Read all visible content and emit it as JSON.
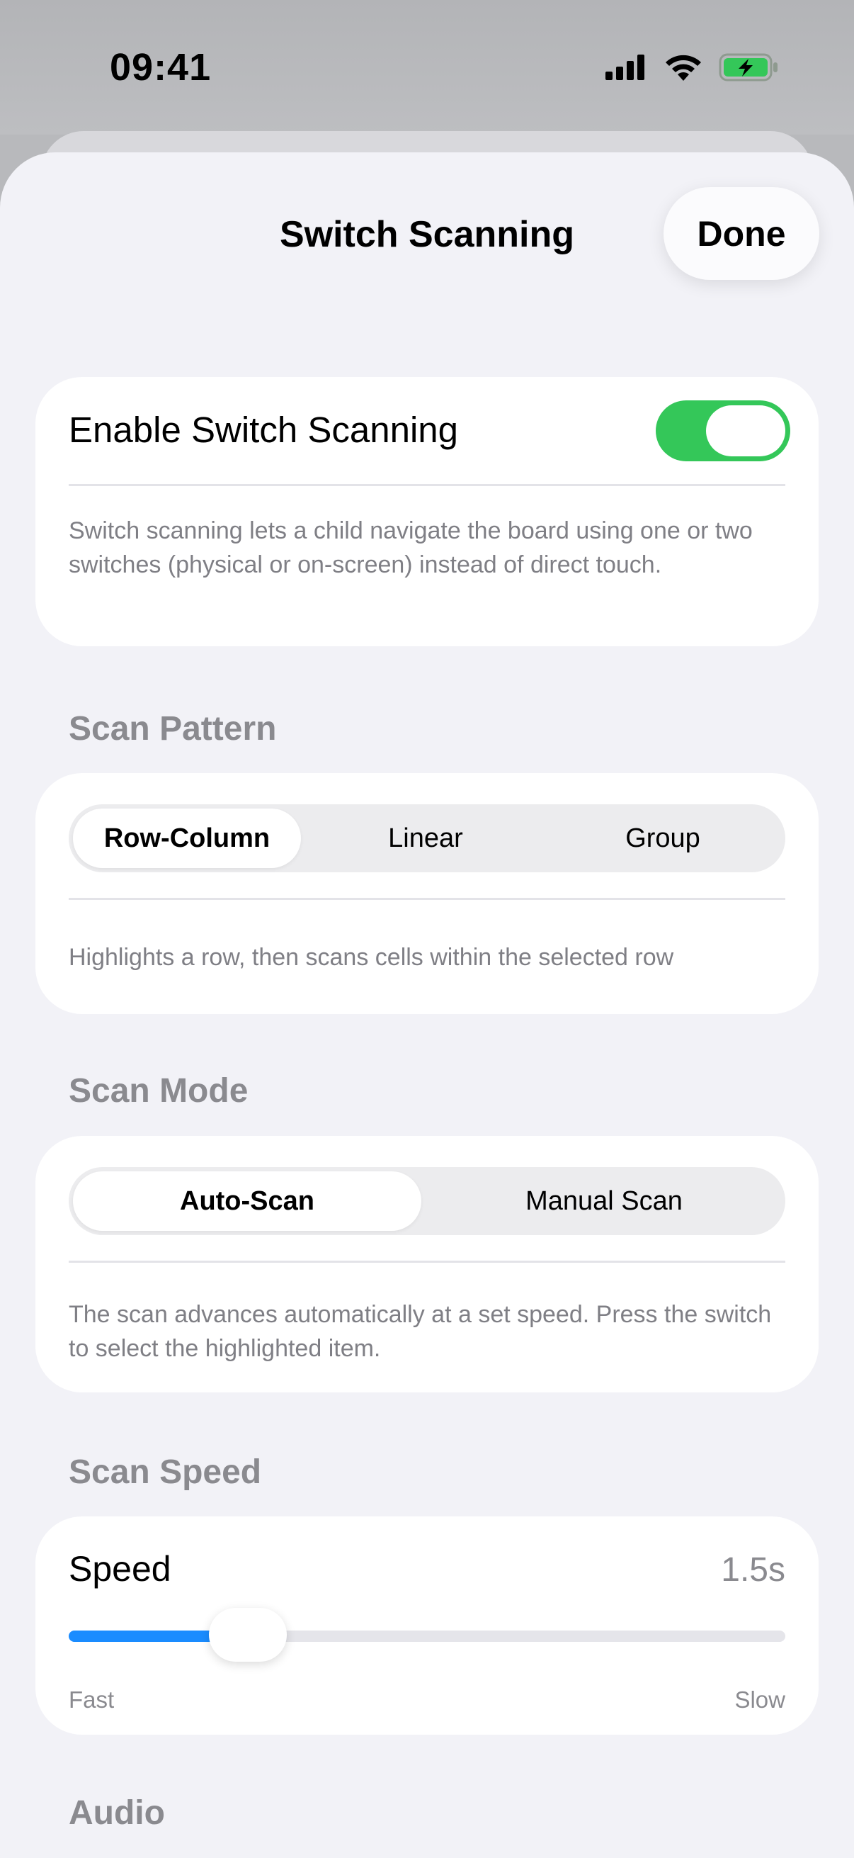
{
  "status_bar": {
    "time": "09:41",
    "icons": [
      "cellular-signal-icon",
      "wifi-icon",
      "battery-charging-icon"
    ],
    "battery_color": "#34c759"
  },
  "header": {
    "title": "Switch Scanning",
    "done_label": "Done"
  },
  "enable_section": {
    "label": "Enable Switch Scanning",
    "toggle_on": true,
    "toggle_color": "#34c759",
    "description": "Switch scanning lets a child navigate the board using one or two switches (physical or on-screen) instead of direct touch."
  },
  "scan_pattern": {
    "header": "Scan Pattern",
    "options": [
      "Row-Column",
      "Linear",
      "Group"
    ],
    "selected": "Row-Column",
    "description": "Highlights a row, then scans cells within the selected row"
  },
  "scan_mode": {
    "header": "Scan Mode",
    "options": [
      "Auto-Scan",
      "Manual Scan"
    ],
    "selected": "Auto-Scan",
    "description": "The scan advances automatically at a set speed. Press the switch to select the highlighted item."
  },
  "scan_speed": {
    "header": "Scan Speed",
    "label": "Speed",
    "value": "1.5s",
    "slider_fraction": 0.25,
    "accent_color": "#1a8cff",
    "min_label": "Fast",
    "max_label": "Slow"
  },
  "audio": {
    "header": "Audio"
  }
}
